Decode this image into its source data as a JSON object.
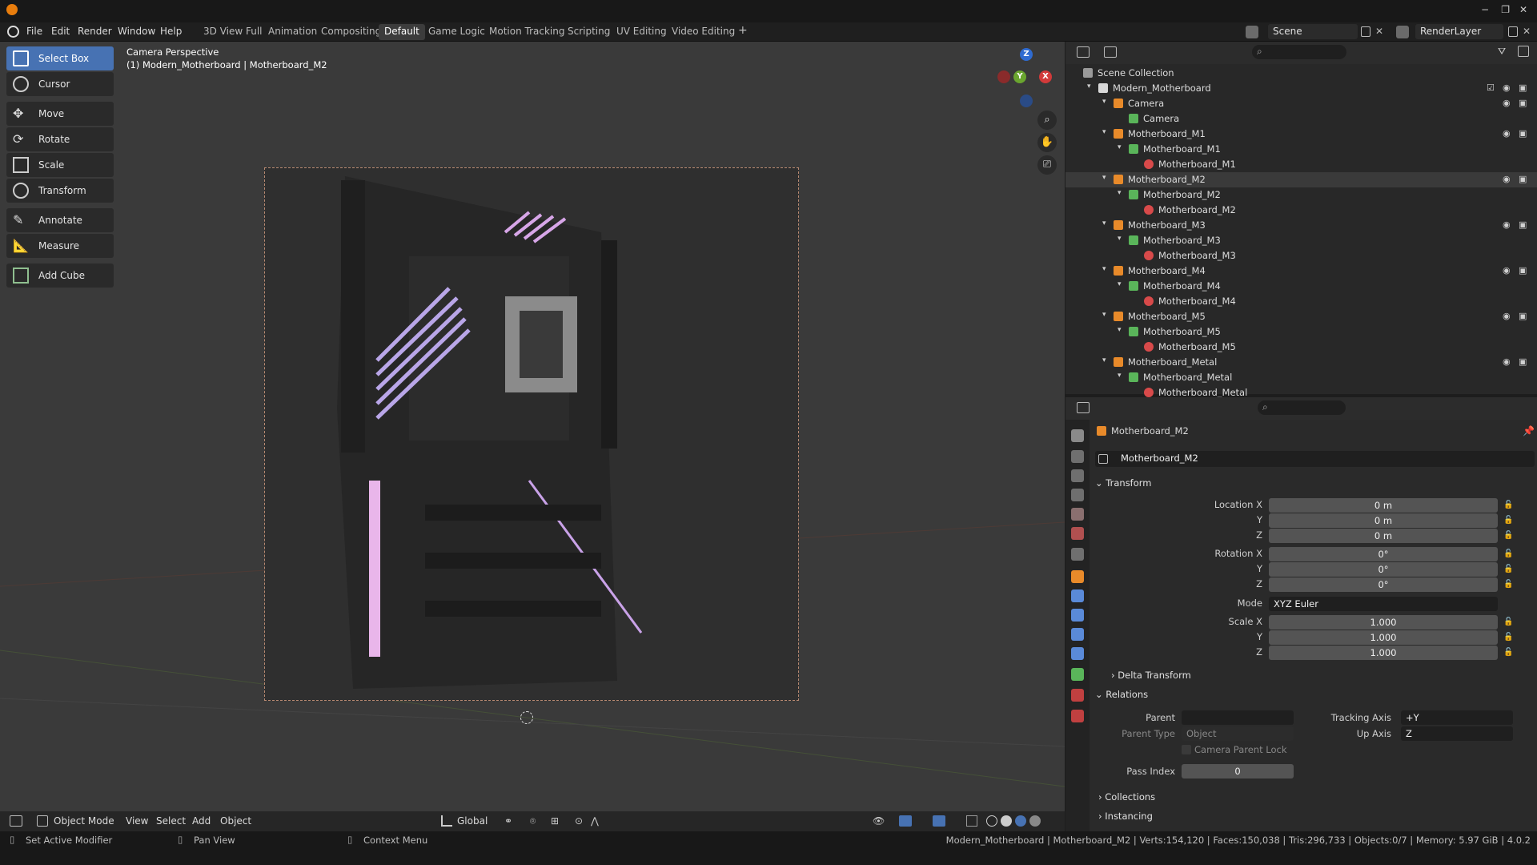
{
  "top": {
    "menus": [
      "File",
      "Edit",
      "Render",
      "Window",
      "Help"
    ],
    "window_controls": [
      "−",
      "❐",
      "✕"
    ]
  },
  "workspaces": [
    "3D View Full",
    "Animation",
    "Compositing",
    "Default",
    "Game Logic",
    "Motion Tracking",
    "Scripting",
    "UV Editing",
    "Video Editing",
    "+"
  ],
  "active_workspace": "Default",
  "scene": {
    "scene_name": "Scene",
    "render_layer": "RenderLayer"
  },
  "toolbar": [
    "Select Box",
    "Cursor",
    "Move",
    "Rotate",
    "Scale",
    "Transform",
    "Annotate",
    "Measure",
    "Add Cube"
  ],
  "viewport": {
    "overlay_title": "Camera Perspective",
    "overlay_subtitle": "(1) Modern_Motherboard | Motherboard_M2",
    "gizmo_axes": [
      "X",
      "Y",
      "Z"
    ]
  },
  "viewport_footer": {
    "mode": "Object Mode",
    "menus": [
      "View",
      "Select",
      "Add",
      "Object"
    ],
    "orientation": "Global"
  },
  "outliner": {
    "rows": [
      {
        "label": "Scene Collection",
        "depth": 0
      },
      {
        "label": "Modern_Motherboard",
        "depth": 1
      },
      {
        "label": "Camera",
        "depth": 2
      },
      {
        "label": "Camera",
        "depth": 3
      },
      {
        "label": "Motherboard_M1",
        "depth": 2
      },
      {
        "label": "Motherboard_M1",
        "depth": 3
      },
      {
        "label": "Motherboard_M1",
        "depth": 4
      },
      {
        "label": "Motherboard_M2",
        "depth": 2
      },
      {
        "label": "Motherboard_M2",
        "depth": 3
      },
      {
        "label": "Motherboard_M2",
        "depth": 4
      },
      {
        "label": "Motherboard_M3",
        "depth": 2
      },
      {
        "label": "Motherboard_M3",
        "depth": 3
      },
      {
        "label": "Motherboard_M3",
        "depth": 4
      },
      {
        "label": "Motherboard_M4",
        "depth": 2
      },
      {
        "label": "Motherboard_M4",
        "depth": 3
      },
      {
        "label": "Motherboard_M4",
        "depth": 4
      },
      {
        "label": "Motherboard_M5",
        "depth": 2
      },
      {
        "label": "Motherboard_M5",
        "depth": 3
      },
      {
        "label": "Motherboard_M5",
        "depth": 4
      },
      {
        "label": "Motherboard_Metal",
        "depth": 2
      },
      {
        "label": "Motherboard_Metal",
        "depth": 3
      },
      {
        "label": "Motherboard_Metal",
        "depth": 4
      }
    ]
  },
  "properties": {
    "object_title": "Motherboard_M2",
    "object_name": "Motherboard_M2",
    "transform_label": "Transform",
    "location_label": "Location X",
    "rotation_label": "Rotation X",
    "scale_label": "Scale X",
    "axis_y": "Y",
    "axis_z": "Z",
    "location": [
      "0 m",
      "0 m",
      "0 m"
    ],
    "rotation": [
      "0°",
      "0°",
      "0°"
    ],
    "mode_label": "Mode",
    "mode_value": "XYZ Euler",
    "scale": [
      "1.000",
      "1.000",
      "1.000"
    ],
    "delta_transform": "Delta Transform",
    "relations": "Relations",
    "parent_label": "Parent",
    "parent_type_label": "Parent Type",
    "parent_type_value": "Object",
    "camera_parent_lock": "Camera Parent Lock",
    "tracking_axis_label": "Tracking Axis",
    "tracking_axis_value": "+Y",
    "up_axis_label": "Up Axis",
    "up_axis_value": "Z",
    "pass_index_label": "Pass Index",
    "pass_index_value": "0",
    "collections": "Collections",
    "instancing": "Instancing"
  },
  "status": {
    "left1": "Set Active Modifier",
    "left2": "Pan View",
    "left3": "Context Menu",
    "right": "Modern_Motherboard | Motherboard_M2 | Verts:154,120 | Faces:150,038 | Tris:296,733 | Objects:0/7 | Memory: 5.97 GiB | 4.0.2"
  }
}
